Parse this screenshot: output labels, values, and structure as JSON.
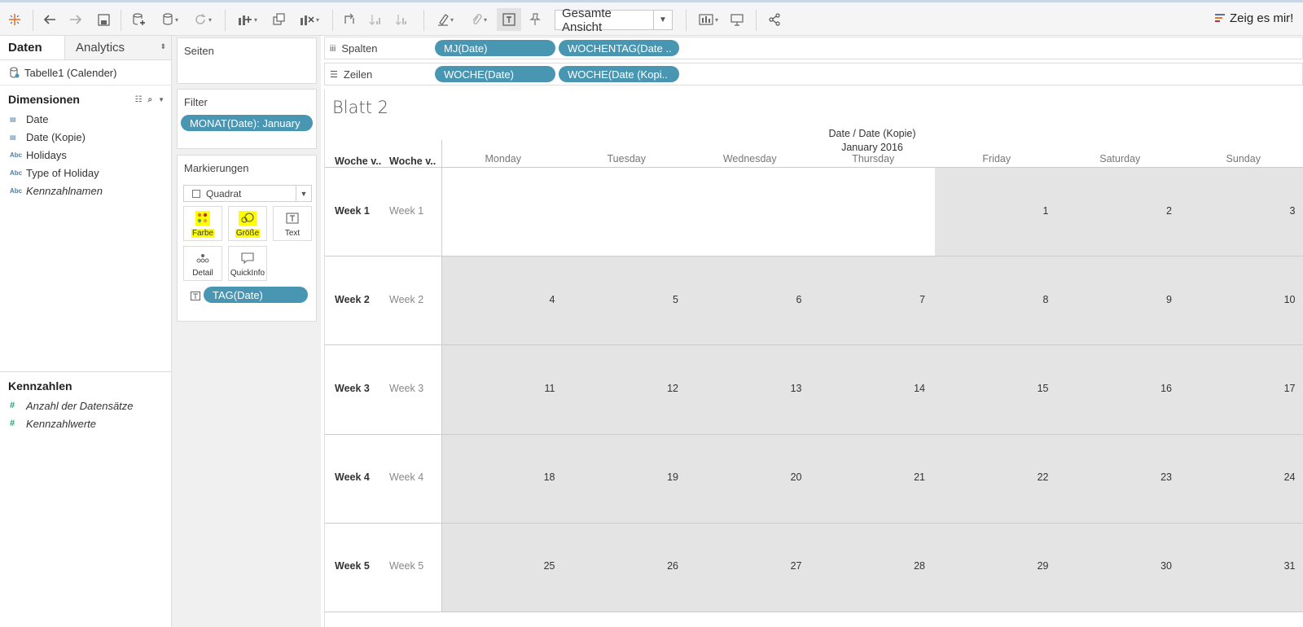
{
  "toolbar": {
    "view_select": "Gesamte Ansicht",
    "show_me": "Zeig es mir!",
    "icons": [
      "tableau-logo-icon",
      "undo-icon",
      "redo-icon",
      "save-icon",
      "new-datasource-icon",
      "pause-updates-icon",
      "refresh-icon",
      "new-worksheet-icon",
      "duplicate-sheet-icon",
      "clear-sheet-icon",
      "swap-icon",
      "sort-ascending-icon",
      "sort-descending-icon",
      "highlight-icon",
      "group-icon",
      "labels-icon",
      "pin-icon",
      "fit-icon",
      "presentation-icon",
      "share-icon"
    ]
  },
  "datapane": {
    "tab_data": "Daten",
    "tab_analytics": "Analytics",
    "datasource": "Tabelle1 (Calender)",
    "dimensions_title": "Dimensionen",
    "dimensions": [
      {
        "icon": "date",
        "label": "Date"
      },
      {
        "icon": "date",
        "label": "Date (Kopie)"
      },
      {
        "icon": "Abc",
        "label": "Holidays"
      },
      {
        "icon": "Abc",
        "label": "Type of Holiday"
      },
      {
        "icon": "Abc",
        "label": "Kennzahlnamen"
      }
    ],
    "measures_title": "Kennzahlen",
    "measures": [
      {
        "icon": "#",
        "label": "Anzahl der Datensätze"
      },
      {
        "icon": "#",
        "label": "Kennzahlwerte"
      }
    ]
  },
  "cards": {
    "pages": "Seiten",
    "filters": "Filter",
    "filter_pill": "MONAT(Date): January",
    "marks": "Markierungen",
    "mark_type": "Quadrat",
    "color": "Farbe",
    "size": "Größe",
    "text": "Text",
    "detail": "Detail",
    "tooltip": "QuickInfo",
    "text_pill": "TAG(Date)"
  },
  "shelves": {
    "columns_label": "Spalten",
    "rows_label": "Zeilen",
    "columns": [
      "MJ(Date)",
      "WOCHENTAG(Date .."
    ],
    "rows": [
      "WOCHE(Date)",
      "WOCHE(Date (Kopi.."
    ]
  },
  "view": {
    "title": "Blatt 2",
    "header_top": "Date / Date (Kopie)",
    "header_month": "January 2016",
    "row_header_1": "Woche v..",
    "row_header_2": "Woche v..",
    "days": [
      "Monday",
      "Tuesday",
      "Wednesday",
      "Thursday",
      "Friday",
      "Saturday",
      "Sunday"
    ],
    "weeks": [
      {
        "label": "Week 1",
        "label2": "Week 1",
        "cells": [
          "",
          "",
          "",
          "",
          "1",
          "2",
          "3"
        ]
      },
      {
        "label": "Week 2",
        "label2": "Week 2",
        "cells": [
          "4",
          "5",
          "6",
          "7",
          "8",
          "9",
          "10"
        ]
      },
      {
        "label": "Week 3",
        "label2": "Week 3",
        "cells": [
          "11",
          "12",
          "13",
          "14",
          "15",
          "16",
          "17"
        ]
      },
      {
        "label": "Week 4",
        "label2": "Week 4",
        "cells": [
          "18",
          "19",
          "20",
          "21",
          "22",
          "23",
          "24"
        ]
      },
      {
        "label": "Week 5",
        "label2": "Week 5",
        "cells": [
          "25",
          "26",
          "27",
          "28",
          "29",
          "30",
          "31"
        ]
      }
    ],
    "cell_fill": "#e4e4e4"
  }
}
